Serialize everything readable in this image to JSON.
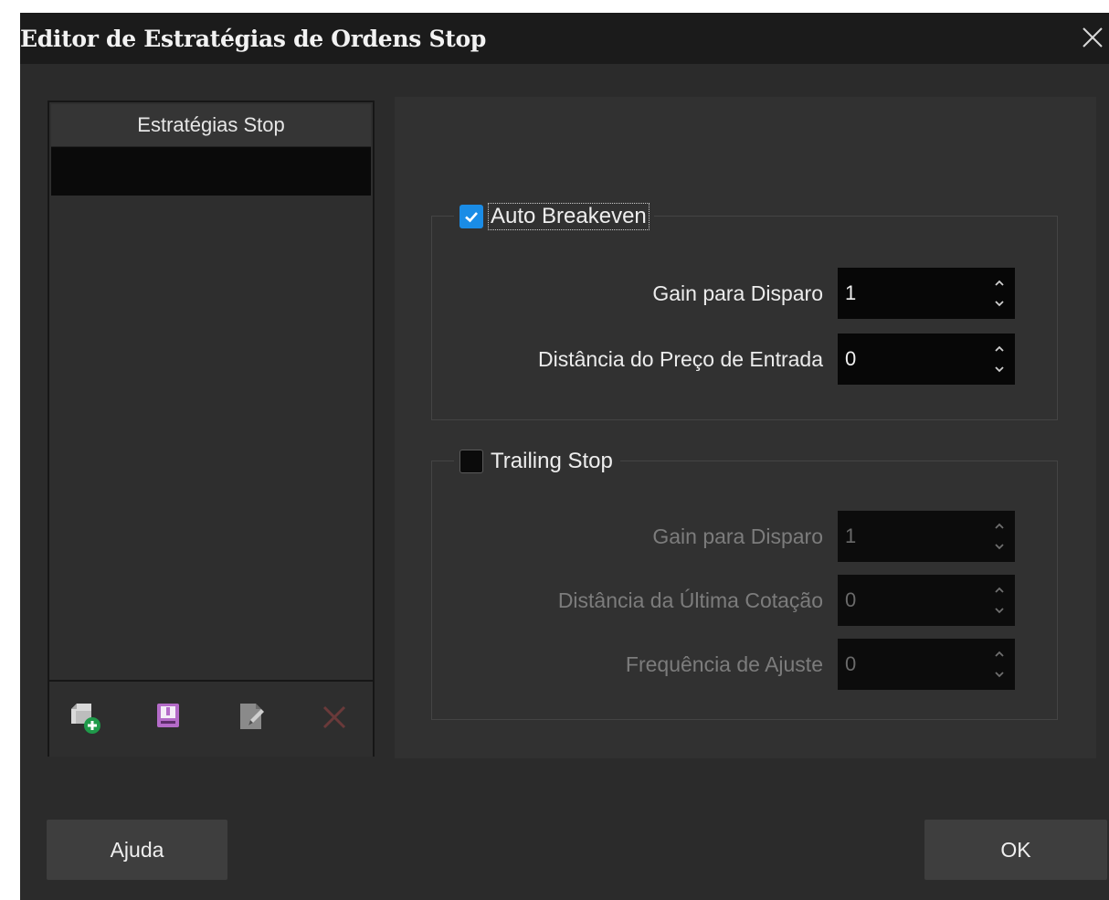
{
  "window": {
    "title": "Editor de Estratégias de Ordens Stop",
    "close_icon": "close-icon"
  },
  "strategy_list": {
    "header": "Estratégias Stop",
    "items": [
      ""
    ],
    "selected_index": 0,
    "toolbar": [
      {
        "name": "add-strategy-button",
        "icon": "add-folder-icon"
      },
      {
        "name": "save-strategy-button",
        "icon": "save-book-icon"
      },
      {
        "name": "rename-strategy-button",
        "icon": "edit-document-icon"
      },
      {
        "name": "delete-strategy-button",
        "icon": "delete-x-icon"
      }
    ]
  },
  "auto_breakeven": {
    "label": "Auto Breakeven",
    "checked": true,
    "fields": [
      {
        "label": "Gain para Disparo",
        "value": "1"
      },
      {
        "label": "Distância do Preço de Entrada",
        "value": "0"
      }
    ]
  },
  "trailing_stop": {
    "label": "Trailing Stop",
    "checked": false,
    "fields": [
      {
        "label": "Gain para Disparo",
        "value": "1"
      },
      {
        "label": "Distância da Última Cotação",
        "value": "0"
      },
      {
        "label": "Frequência de Ajuste",
        "value": "0"
      }
    ]
  },
  "buttons": {
    "help_label": "Ajuda",
    "ok_label": "OK"
  },
  "colors": {
    "accent": "#1a8ce6",
    "background": "#2b2b2b",
    "titlebar": "#1b1b1b"
  }
}
